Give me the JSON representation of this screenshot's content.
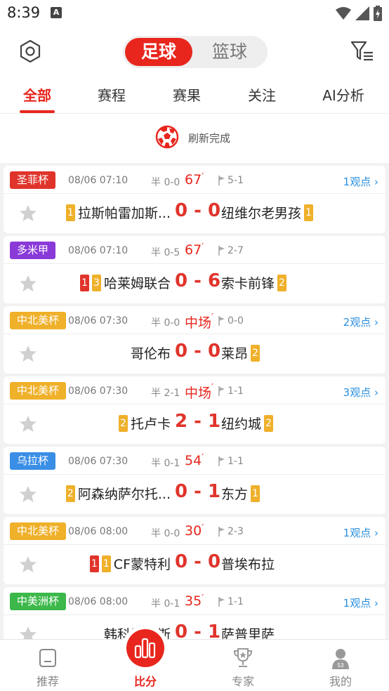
{
  "status": {
    "time": "8:39"
  },
  "sport_switch": {
    "active": "足球",
    "inactive": "篮球"
  },
  "tabs": [
    "全部",
    "赛程",
    "赛果",
    "关注",
    "AI分析"
  ],
  "refresh": {
    "text": "刷新完成"
  },
  "colors": {
    "accent": "#e8261d",
    "score": "#e0342b",
    "link": "#2a8fe0"
  },
  "matches": [
    {
      "league": "圣菲杯",
      "league_color": "#e0342b",
      "time": "08/06 07:10",
      "half": "半 0-0",
      "minute": "67",
      "corner": "5-1",
      "views": "1观点",
      "home": "拉斯帕雷加斯...",
      "home_badges": [
        {
          "t": "1",
          "c": "y"
        }
      ],
      "score": "0 - 0",
      "away": "纽维尔老男孩",
      "away_badges": [
        {
          "t": "1",
          "c": "y"
        }
      ]
    },
    {
      "league": "多米甲",
      "league_color": "#8a3ad8",
      "time": "08/06 07:10",
      "half": "半 0-5",
      "minute": "67",
      "corner": "2-7",
      "views": "",
      "home": "哈莱姆联合",
      "home_badges": [
        {
          "t": "1",
          "c": "r"
        },
        {
          "t": "3",
          "c": "y"
        }
      ],
      "score": "0 - 6",
      "away": "索卡前锋",
      "away_badges": [
        {
          "t": "2",
          "c": "y"
        }
      ]
    },
    {
      "league": "中北美杯",
      "league_color": "#efb02a",
      "time": "08/06 07:30",
      "half": "半 0-0",
      "minute": "中场",
      "corner": "0-0",
      "views": "2观点",
      "home": "哥伦布",
      "home_badges": [],
      "score": "0 - 0",
      "away": "莱昂",
      "away_badges": [
        {
          "t": "2",
          "c": "y"
        }
      ]
    },
    {
      "league": "中北美杯",
      "league_color": "#efb02a",
      "time": "08/06 07:30",
      "half": "半 2-1",
      "minute": "中场",
      "corner": "1-1",
      "views": "3观点",
      "home": "托卢卡",
      "home_badges": [
        {
          "t": "2",
          "c": "y"
        }
      ],
      "score": "2 - 1",
      "away": "纽约城",
      "away_badges": [
        {
          "t": "2",
          "c": "y"
        }
      ]
    },
    {
      "league": "乌拉杯",
      "league_color": "#3a8ee6",
      "time": "08/06 07:30",
      "half": "半 0-1",
      "minute": "54",
      "corner": "1-1",
      "views": "",
      "home": "阿森纳萨尔托...",
      "home_badges": [
        {
          "t": "2",
          "c": "y"
        }
      ],
      "score": "0 - 1",
      "away": "东方",
      "away_badges": [
        {
          "t": "1",
          "c": "y"
        }
      ]
    },
    {
      "league": "中北美杯",
      "league_color": "#efb02a",
      "time": "08/06 08:00",
      "half": "半 0-0",
      "minute": "30",
      "corner": "2-3",
      "views": "1观点",
      "home": "CF蒙特利",
      "home_badges": [
        {
          "t": "1",
          "c": "r"
        },
        {
          "t": "1",
          "c": "y"
        }
      ],
      "score": "0 - 0",
      "away": "普埃布拉",
      "away_badges": []
    },
    {
      "league": "中美洲杯",
      "league_color": "#3cb84a",
      "time": "08/06 08:00",
      "half": "半 0-1",
      "minute": "35",
      "corner": "1-1",
      "views": "1观点",
      "home": "韩科斯…斯",
      "home_badges": [],
      "score": "0 - 1",
      "away": "萨普里萨",
      "away_badges": []
    }
  ],
  "bottom_nav": {
    "recommend": "推荐",
    "score": "比分",
    "expert": "专家",
    "mine": "我的",
    "mine_badge": "53"
  }
}
